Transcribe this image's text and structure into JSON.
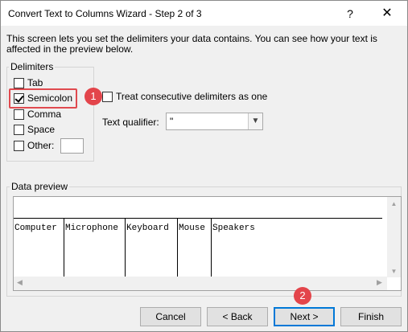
{
  "window": {
    "title": "Convert Text to Columns Wizard - Step 2 of 3",
    "help": "?",
    "close": "✕"
  },
  "intro": "This screen lets you set the delimiters your data contains.  You can see how your text is affected in the preview below.",
  "delimiters": {
    "group_label": "Delimiters",
    "tab": {
      "label": "Tab",
      "checked": false
    },
    "semicolon": {
      "label": "Semicolon",
      "checked": true
    },
    "comma": {
      "label": "Comma",
      "checked": false
    },
    "space": {
      "label": "Space",
      "checked": false
    },
    "other": {
      "label": "Other:",
      "checked": false,
      "value": ""
    }
  },
  "consecutive": {
    "label": "Treat consecutive delimiters as one",
    "checked": false
  },
  "qualifier": {
    "label": "Text qualifier:",
    "value": "\""
  },
  "preview": {
    "label": "Data preview",
    "columns": [
      "Computer",
      "Microphone",
      "Keyboard",
      "Mouse",
      "Speakers"
    ]
  },
  "markers": {
    "one": "1",
    "two": "2"
  },
  "buttons": {
    "cancel": "Cancel",
    "back": "< Back",
    "next": "Next >",
    "finish": "Finish"
  },
  "colors": {
    "marker": "#e3454b",
    "primary_border": "#0078d7"
  }
}
